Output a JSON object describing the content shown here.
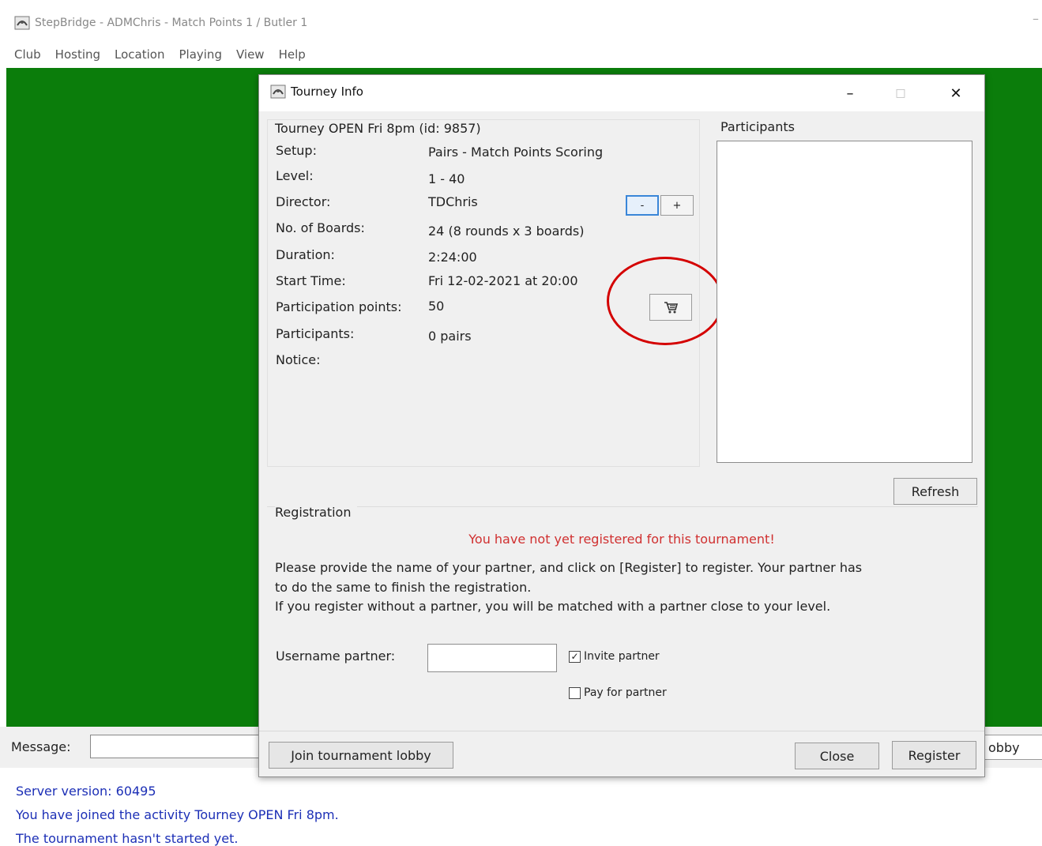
{
  "app": {
    "title": "StepBridge - ADMChris - Match Points 1 / Butler 1",
    "minimize_glyph": "–"
  },
  "menu": [
    "Club",
    "Hosting",
    "Location",
    "Playing",
    "View",
    "Help"
  ],
  "message_bar": {
    "label": "Message:",
    "input_value": "",
    "right_button_partial": "obby"
  },
  "log": {
    "lines": [
      "Server version: 60495",
      "You have joined the activity Tourney OPEN Fri 8pm.",
      "The tournament hasn't started yet."
    ]
  },
  "dialog": {
    "title": "Tourney Info",
    "controls": {
      "minimize": "–",
      "maximize": "□",
      "close": "✕"
    },
    "info_title": "Tourney OPEN Fri 8pm (id: 9857)",
    "rows": [
      {
        "label": "Setup:",
        "value": "Pairs - Match Points Scoring"
      },
      {
        "label": "Level:",
        "value": "1 - 40"
      },
      {
        "label": "Director:",
        "value": "TDChris"
      },
      {
        "label": "No. of Boards:",
        "value": "24 (8 rounds x 3 boards)"
      },
      {
        "label": "Duration:",
        "value": "2:24:00"
      },
      {
        "label": "Start Time:",
        "value": "Fri 12-02-2021 at 20:00"
      },
      {
        "label": "Participation points:",
        "value": "50"
      },
      {
        "label": "Participants:",
        "value": "0 pairs"
      },
      {
        "label": "Notice:",
        "value": ""
      }
    ],
    "minus_label": "-",
    "plus_label": "+",
    "participants_title": "Participants",
    "participants": [],
    "refresh_label": "Refresh",
    "registration_title": "Registration",
    "warning": "You have not yet registered for this tournament!",
    "instructions": [
      "Please provide the name of your partner, and click on [Register] to register. Your partner has",
      "to do the same to finish the registration.",
      "If you register without a partner, you will be matched with a partner close to your level."
    ],
    "username_label": "Username partner:",
    "username_value": "",
    "invite_partner": {
      "label": "Invite partner",
      "checked": true
    },
    "pay_for_partner": {
      "label": "Pay for partner",
      "checked": false
    },
    "join_lobby_label": "Join tournament lobby",
    "close_label": "Close",
    "register_label": "Register"
  },
  "colors": {
    "green_background": "#0b7d0b",
    "warning_red": "#d03030",
    "log_blue": "#1c2fb6",
    "highlight_circle": "#d40000"
  }
}
